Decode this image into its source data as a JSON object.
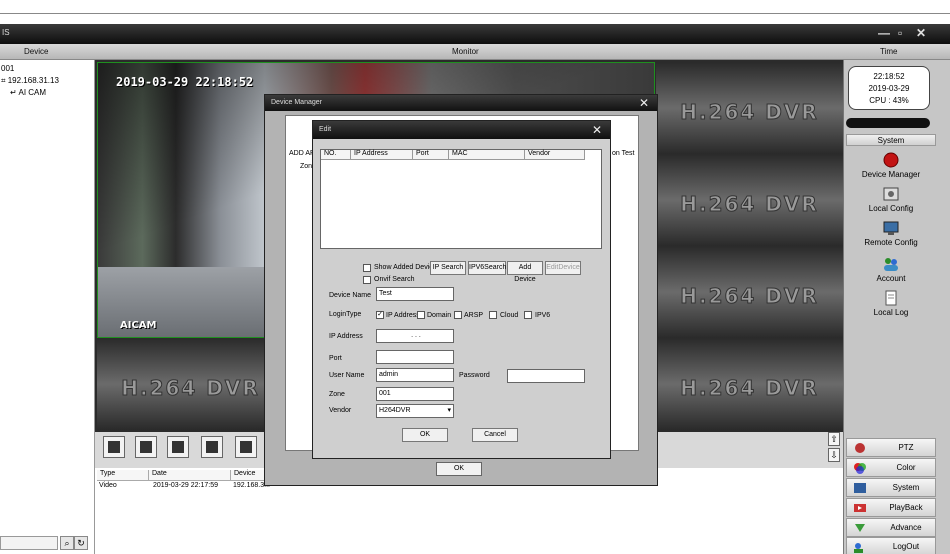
{
  "window": {
    "title": "IS",
    "controls": [
      "—",
      "▫",
      "✕"
    ]
  },
  "header": {
    "device": "Device",
    "monitor": "Monitor",
    "time": "Time"
  },
  "tree": {
    "root": "001",
    "ip": "192.168.31.13",
    "cam": "AI CAM"
  },
  "camera": {
    "timestamp": "2019-03-29 22:18:52",
    "name": "AICAM"
  },
  "grid": {
    "placeholder": "H.264 DVR"
  },
  "log": {
    "headers": [
      "Type",
      "Date",
      "Device"
    ],
    "row": {
      "type": "Video",
      "date": "2019-03-29 22:17:59",
      "device": "192.168.3..."
    }
  },
  "clock": {
    "time": "22:18:52",
    "date": "2019-03-29",
    "cpu": "CPU : 43%"
  },
  "right": {
    "system_header": "System",
    "items": [
      "Device Manager",
      "Local Config",
      "Remote Config",
      "Account",
      "Local Log"
    ],
    "bottom": [
      "PTZ",
      "Color",
      "System",
      "PlayBack",
      "Advance",
      "LogOut"
    ]
  },
  "device_manager": {
    "title": "Device Manager",
    "add_area": "ADD AR",
    "tree_zone": "Zone",
    "on_test": "on Test",
    "ok": "OK"
  },
  "edit": {
    "title": "Edit",
    "table_headers": [
      "NO.",
      "IP Address",
      "Port",
      "MAC",
      "Vendor"
    ],
    "show_added": "Show Added Devic",
    "onvif_search": "Onvif Search",
    "buttons": {
      "ip_search": "IP Search",
      "ipv6_search": "IPV6Search",
      "add_device": "Add Device",
      "edit_device": "EditDevice"
    },
    "device_name_label": "Device Name",
    "device_name_value": "Test",
    "login_type_label": "LoginType",
    "login_options": [
      "IP Address",
      "Domain",
      "ARSP",
      "Cloud",
      "IPV6"
    ],
    "ip_address_label": "IP Address",
    "ip_value": ".   .   .",
    "port_label": "Port",
    "username_label": "User Name",
    "username_value": "admin",
    "password_label": "Password",
    "zone_label": "Zone",
    "zone_value": "001",
    "vendor_label": "Vendor",
    "vendor_value": "H264DVR",
    "ok": "OK",
    "cancel": "Cancel"
  }
}
